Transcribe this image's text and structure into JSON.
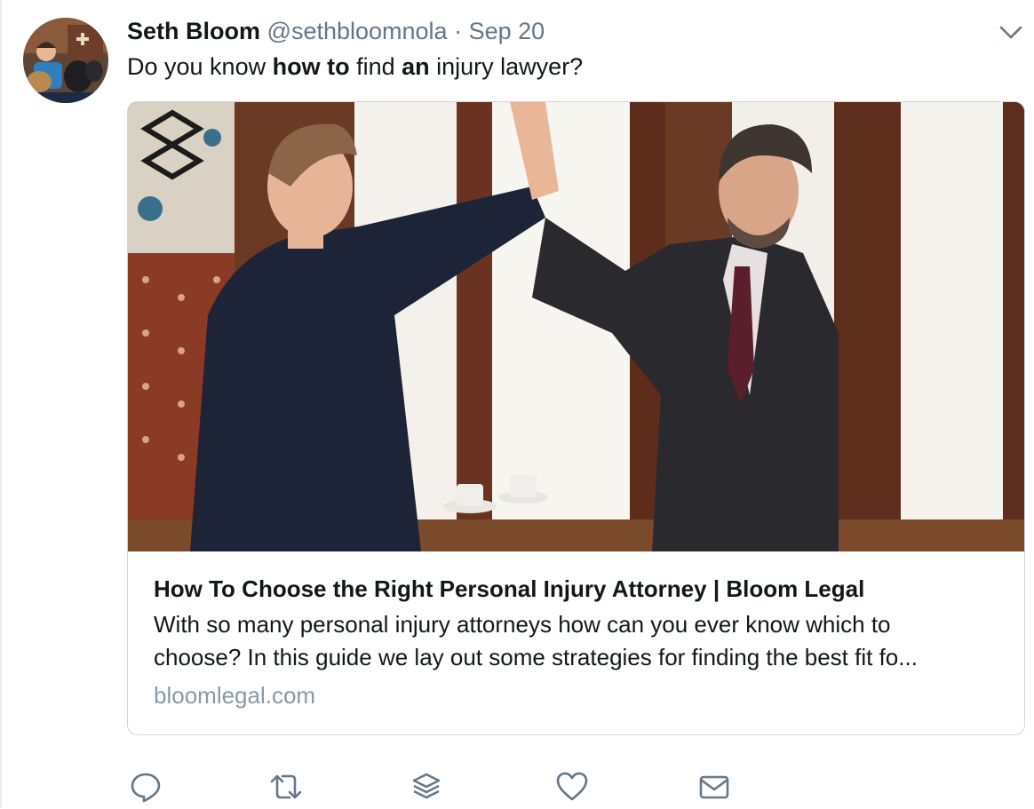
{
  "tweet": {
    "author_name": "Seth Bloom",
    "handle": "@sethbloomnola",
    "separator": "·",
    "date": "Sep 20",
    "text_parts": [
      "Do you know ",
      "how to",
      " find ",
      "an",
      " injury lawyer?"
    ]
  },
  "card": {
    "title": "How To Choose the Right Personal Injury Attorney | Bloom Legal",
    "description_line1": "With so many personal injury attorneys how can you ever know which to",
    "description_line2": "choose? In this guide we lay out some strategies for finding the best fit fo...",
    "domain": "bloomlegal.com"
  },
  "actions": [
    {
      "name": "reply",
      "icon": "reply-icon"
    },
    {
      "name": "retweet",
      "icon": "retweet-icon"
    },
    {
      "name": "stack",
      "icon": "stack-icon"
    },
    {
      "name": "like",
      "icon": "heart-icon"
    },
    {
      "name": "message",
      "icon": "envelope-icon"
    }
  ],
  "colors": {
    "text": "#14171a",
    "muted": "#657786",
    "domain": "#8899a6",
    "border": "#ccd6dd",
    "icon": "#657786"
  }
}
